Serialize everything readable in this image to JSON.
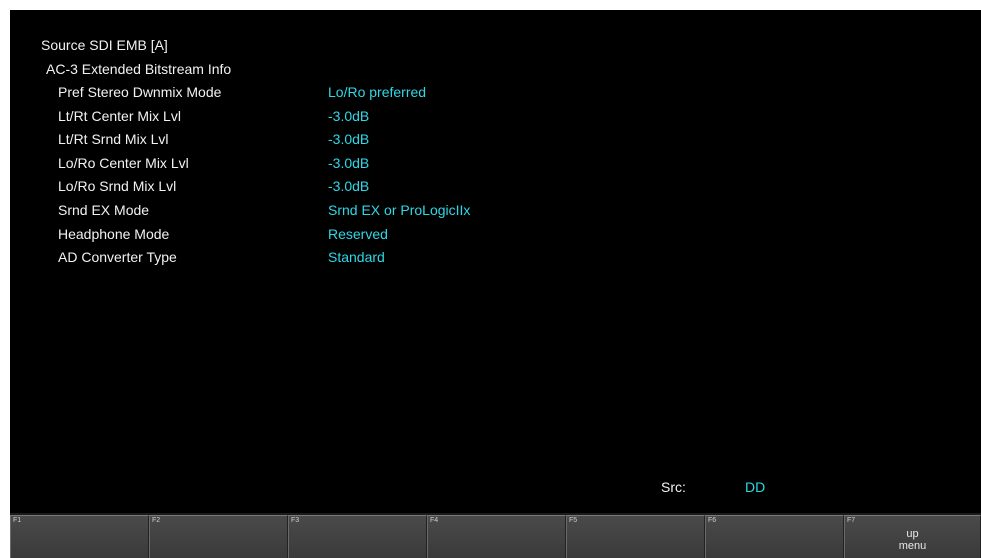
{
  "header": {
    "source_title": "Source SDI EMB [A]",
    "section_title": "AC-3 Extended Bitstream Info"
  },
  "info_rows": [
    {
      "label": "Pref Stereo Dwnmix Mode",
      "value": "Lo/Ro preferred"
    },
    {
      "label": "Lt/Rt Center Mix Lvl",
      "value": "-3.0dB"
    },
    {
      "label": "Lt/Rt Srnd Mix Lvl",
      "value": "-3.0dB"
    },
    {
      "label": "Lo/Ro Center Mix Lvl",
      "value": "-3.0dB"
    },
    {
      "label": "Lo/Ro Srnd Mix Lvl",
      "value": "-3.0dB"
    },
    {
      "label": "Srnd EX Mode",
      "value": "Srnd EX or ProLogicIIx"
    },
    {
      "label": "Headphone Mode",
      "value": "Reserved"
    },
    {
      "label": "AD Converter Type",
      "value": "Standard"
    }
  ],
  "status": {
    "src_label": "Src:",
    "src_value": "DD"
  },
  "function_keys": [
    {
      "num": "F1",
      "label_line1": "",
      "label_line2": ""
    },
    {
      "num": "F2",
      "label_line1": "",
      "label_line2": ""
    },
    {
      "num": "F3",
      "label_line1": "",
      "label_line2": ""
    },
    {
      "num": "F4",
      "label_line1": "",
      "label_line2": ""
    },
    {
      "num": "F5",
      "label_line1": "",
      "label_line2": ""
    },
    {
      "num": "F6",
      "label_line1": "",
      "label_line2": ""
    },
    {
      "num": "F7",
      "label_line1": "up",
      "label_line2": "menu"
    }
  ],
  "colors": {
    "background": "#000000",
    "label_text": "#f2f2f2",
    "value_text": "#2fd8e6",
    "function_key": "#424242"
  }
}
